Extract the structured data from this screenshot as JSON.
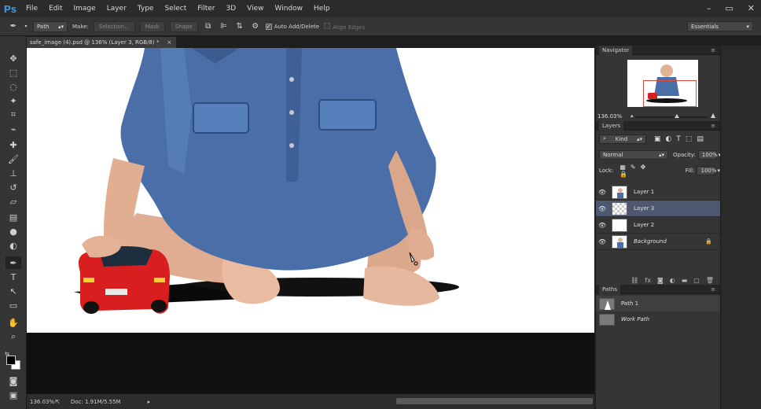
{
  "app": {
    "logo": "Ps"
  },
  "menu": [
    "File",
    "Edit",
    "Image",
    "Layer",
    "Type",
    "Select",
    "Filter",
    "3D",
    "View",
    "Window",
    "Help"
  ],
  "window_controls": {
    "minimize": "–",
    "restore": "▭",
    "close": "✕"
  },
  "options": {
    "mode_value": "Path",
    "make_label": "Make:",
    "selection_btn": "Selection...",
    "mask_btn": "Mask",
    "shape_btn": "Shape",
    "auto_add_delete": "Auto Add/Delete",
    "align_edges": "Align Edges",
    "workspace": "Essentials"
  },
  "document": {
    "tab_title": "safe_image (4).psd @ 136% (Layer 3, RGB/8) *",
    "tab_close": "×",
    "zoom": "136.03%",
    "doc_info": "Doc: 1.91M/5.55M"
  },
  "navigator": {
    "title": "Navigator",
    "zoom": "136.03%"
  },
  "layers": {
    "title": "Layers",
    "kind_filter": "Kind",
    "blend_mode": "Normal",
    "opacity_label": "Opacity:",
    "opacity_value": "100%",
    "lock_label": "Lock:",
    "fill_label": "Fill:",
    "fill_value": "100%",
    "items": [
      {
        "name": "Layer 1"
      },
      {
        "name": "Layer 3"
      },
      {
        "name": "Layer 2"
      },
      {
        "name": "Background"
      }
    ]
  },
  "paths": {
    "title": "Paths",
    "items": [
      {
        "name": "Path 1"
      },
      {
        "name": "Work Path"
      }
    ]
  },
  "colors": {
    "accent": "#3ea0e8",
    "selection": "#4d5870",
    "nav_frame": "#e04a3a"
  }
}
